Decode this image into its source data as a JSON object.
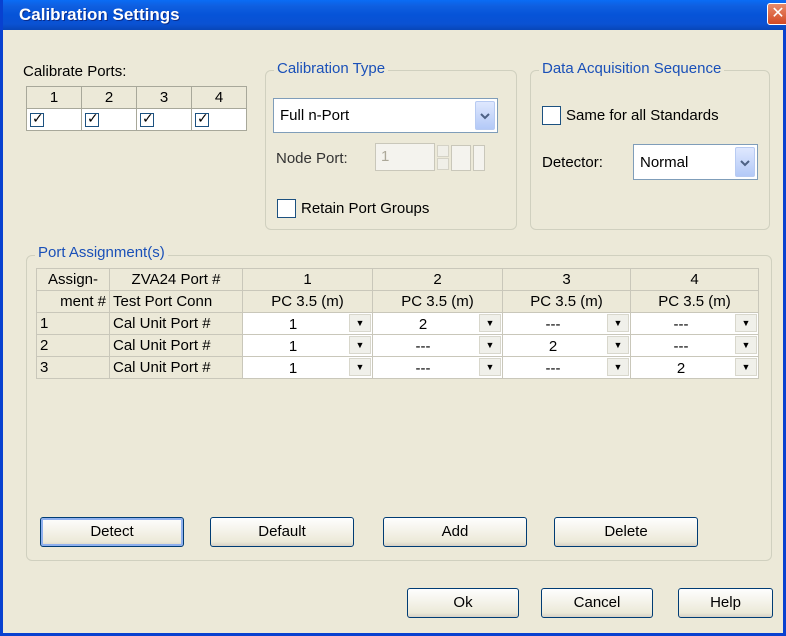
{
  "window": {
    "title": "Calibration Settings",
    "close_glyph": "✕"
  },
  "calibrate_ports": {
    "label": "Calibrate Ports:",
    "ports": [
      {
        "label": "1",
        "checked": true
      },
      {
        "label": "2",
        "checked": true
      },
      {
        "label": "3",
        "checked": true
      },
      {
        "label": "4",
        "checked": true
      }
    ],
    "check_glyph": "✓"
  },
  "calibration_type": {
    "title": "Calibration Type",
    "type_value": "Full n-Port",
    "node_port_label": "Node Port:",
    "node_port_value": "1",
    "retain_port_groups_label": "Retain Port Groups"
  },
  "data_acquisition": {
    "title": "Data Acquisition Sequence",
    "same_for_all_label": "Same for all Standards",
    "detector_label": "Detector:",
    "detector_value": "Normal"
  },
  "port_assignment": {
    "title": "Port Assignment(s)",
    "header1": {
      "assign": "Assign-",
      "zva": "ZVA24 Port #",
      "ports": [
        "1",
        "2",
        "3",
        "4"
      ]
    },
    "header2": {
      "assign": "ment #",
      "conn": "Test Port Conn",
      "connectors": [
        "PC 3.5 (m)",
        "PC 3.5 (m)",
        "PC 3.5 (m)",
        "PC 3.5 (m)"
      ]
    },
    "rows": [
      {
        "num": "1",
        "label": "Cal Unit Port #",
        "values": [
          "1",
          "2",
          "---",
          "---"
        ]
      },
      {
        "num": "2",
        "label": "Cal Unit Port #",
        "values": [
          "1",
          "---",
          "2",
          "---"
        ]
      },
      {
        "num": "3",
        "label": "Cal Unit Port #",
        "values": [
          "1",
          "---",
          "---",
          "2"
        ]
      }
    ],
    "buttons": {
      "detect": "Detect",
      "default": "Default",
      "add": "Add",
      "delete": "Delete"
    }
  },
  "footer": {
    "ok": "Ok",
    "cancel": "Cancel",
    "help": "Help"
  },
  "colors": {
    "title_bar": "#0653d8",
    "group_title": "#1a50b8",
    "dialog_bg": "#ece9d8"
  }
}
